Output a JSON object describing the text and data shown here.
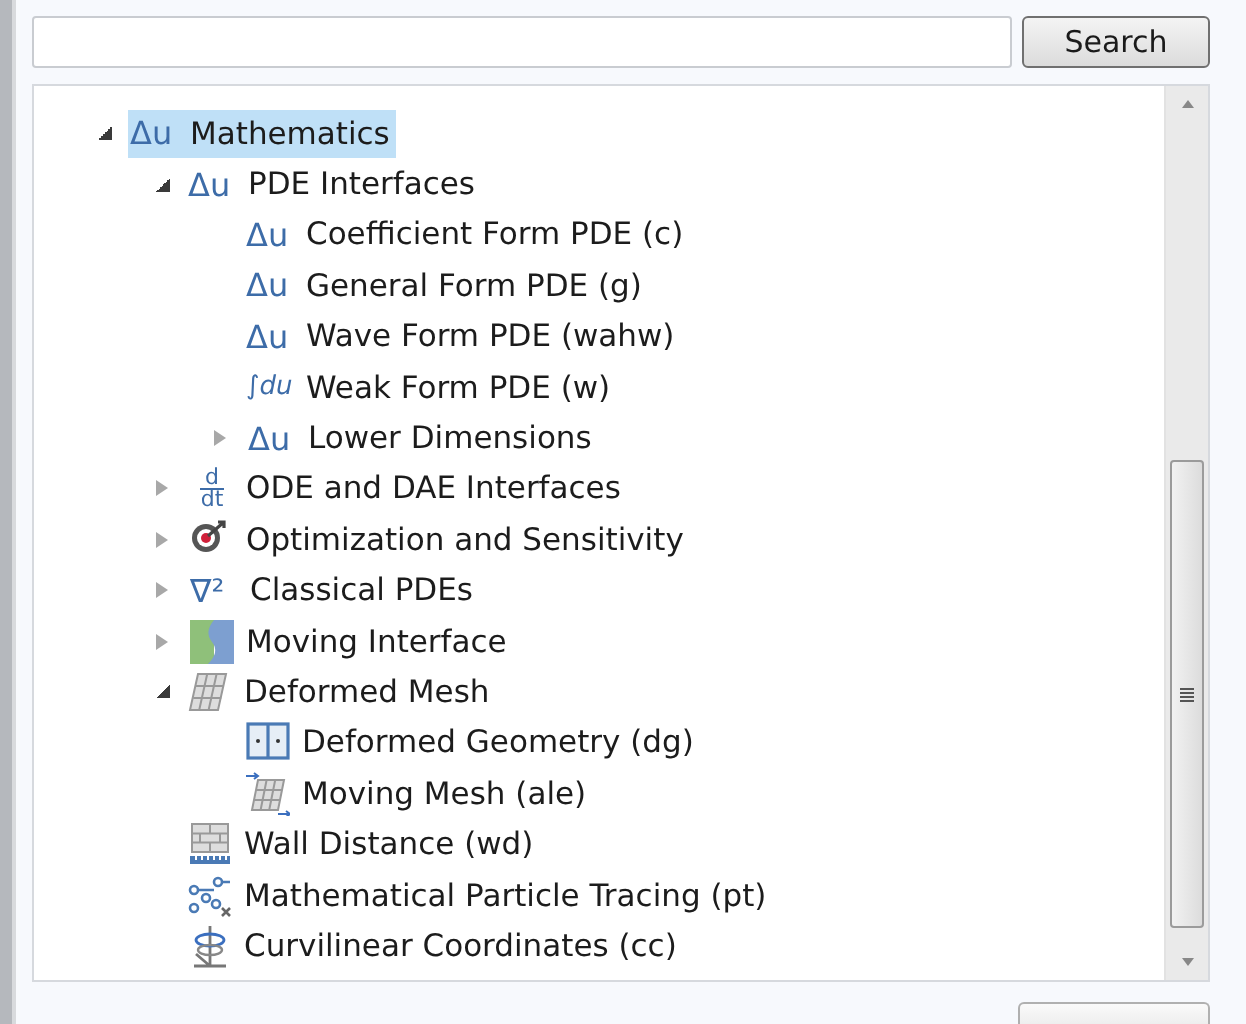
{
  "search": {
    "button": "Search"
  },
  "tree": [
    {
      "label": "Mathematics",
      "selected": true,
      "expanded": true,
      "kind": "symbol",
      "symbol": "Δu",
      "children": [
        {
          "label": "PDE Interfaces",
          "selected": false,
          "expanded": true,
          "kind": "symbol",
          "symbol": "Δu",
          "children": [
            {
              "label": "Coefficient Form PDE (c)",
              "selected": false,
              "kind": "symbol",
              "symbol": "Δu"
            },
            {
              "label": "General Form PDE (g)",
              "selected": false,
              "kind": "symbol",
              "symbol": "Δu"
            },
            {
              "label": "Wave Form PDE (wahw)",
              "selected": false,
              "kind": "symbol",
              "symbol": "Δu"
            },
            {
              "label": "Weak Form PDE (w)",
              "selected": false,
              "kind": "italic",
              "symbol": "∫du"
            },
            {
              "label": "Lower Dimensions",
              "selected": false,
              "expanded": false,
              "kind": "symbol",
              "symbol": "Δu"
            }
          ]
        },
        {
          "label": "ODE and DAE Interfaces",
          "selected": false,
          "expanded": false,
          "kind": "fraction",
          "numerator": "d",
          "denominator": "dt"
        },
        {
          "label": "Optimization and Sensitivity",
          "selected": false,
          "expanded": false,
          "kind": "target"
        },
        {
          "label": "Classical PDEs",
          "selected": false,
          "expanded": false,
          "kind": "symbol",
          "symbol": "∇²"
        },
        {
          "label": "Moving Interface",
          "selected": false,
          "expanded": false,
          "kind": "interface"
        },
        {
          "label": "Deformed Mesh",
          "selected": false,
          "expanded": true,
          "kind": "mesh",
          "children": [
            {
              "label": "Deformed Geometry (dg)",
              "selected": false,
              "kind": "geometry"
            },
            {
              "label": "Moving Mesh (ale)",
              "selected": false,
              "kind": "moving-mesh"
            }
          ]
        },
        {
          "label": "Wall Distance (wd)",
          "selected": false,
          "kind": "wall"
        },
        {
          "label": "Mathematical Particle Tracing (pt)",
          "selected": false,
          "kind": "particles"
        },
        {
          "label": "Curvilinear Coordinates (cc)",
          "selected": false,
          "kind": "coordinates"
        }
      ]
    }
  ]
}
